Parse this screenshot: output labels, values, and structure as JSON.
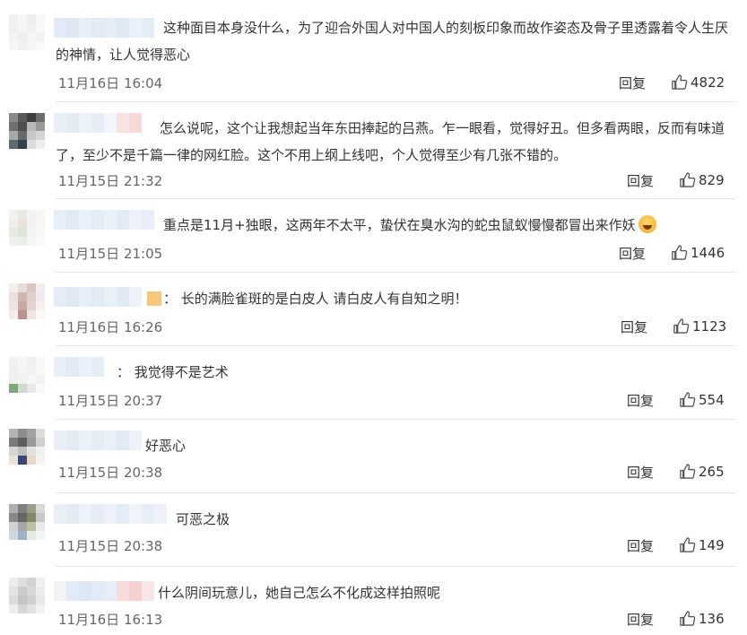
{
  "reply_label": "回复",
  "comments": [
    {
      "text": "这种面目本身没什么，为了迎合外国人对中国人的刻板印象而故作姿态及骨子里透露着令人生厌的神情，让人觉得恶心",
      "time": "11月16日 16:04",
      "likes": "4822"
    },
    {
      "text": "怎么说呢，这个让我想起当年东田捧起的吕燕。乍一眼看，觉得好丑。但多看两眼，反而有味道了，至少不是千篇一律的网红脸。这个不用上纲上线吧，个人觉得至少有几张不错的。",
      "time": "11月15日 21:32",
      "likes": "829"
    },
    {
      "text": "重点是11月+独眼，这两年不太平，蛰伏在臭水沟的蛇虫鼠蚁慢慢都冒出来作妖",
      "time": "11月15日 21:05",
      "likes": "1446"
    },
    {
      "text": "：  长的满脸雀斑的是白皮人 请白皮人有自知之明！",
      "time": "11月16日 16:26",
      "likes": "1123"
    },
    {
      "text": "：  我觉得不是艺术",
      "time": "11月15日 20:37",
      "likes": "554"
    },
    {
      "text": "好恶心",
      "time": "11月15日 20:38",
      "likes": "265"
    },
    {
      "text": "可恶之极",
      "time": "11月15日 20:38",
      "likes": "149"
    },
    {
      "text": "什么阴间玩意儿，她自己怎么不化成这样拍照呢",
      "time": "11月16日 16:13",
      "likes": "136"
    }
  ]
}
